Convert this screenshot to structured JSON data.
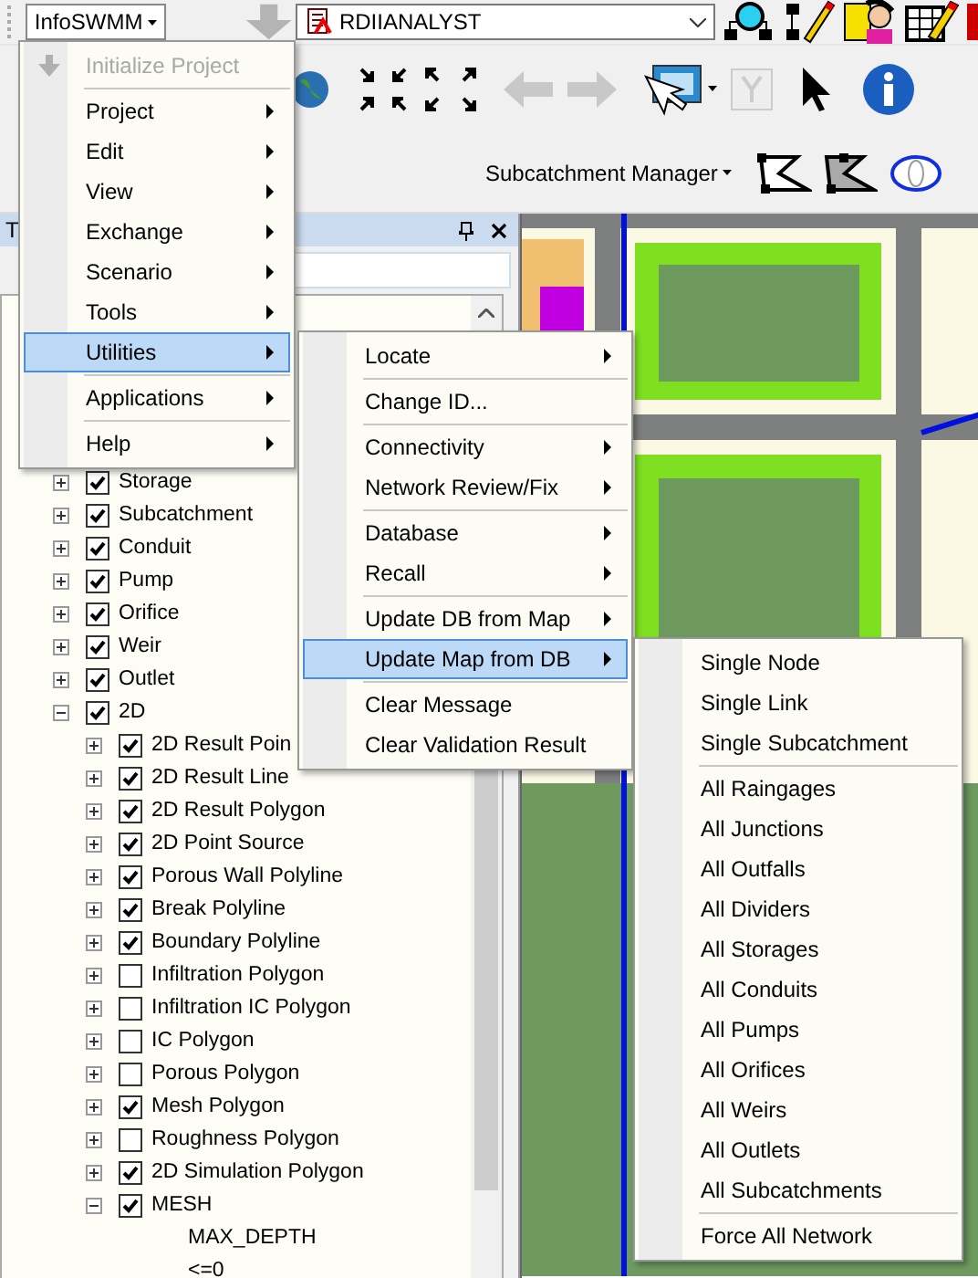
{
  "toolbar": {
    "app_menu": "InfoSWMM",
    "database": "RDIIANALYST"
  },
  "manager_bar": {
    "manager": "Subcatchment Manager"
  },
  "panel": {
    "title": "T"
  },
  "tree": [
    {
      "label": "Storage",
      "kind": "layer",
      "checked": true,
      "expanded": false
    },
    {
      "label": "Subcatchment",
      "kind": "layer",
      "checked": true,
      "expanded": false
    },
    {
      "label": "Conduit",
      "kind": "layer",
      "checked": true,
      "expanded": false
    },
    {
      "label": "Pump",
      "kind": "layer",
      "checked": true,
      "expanded": false
    },
    {
      "label": "Orifice",
      "kind": "layer",
      "checked": true,
      "expanded": false
    },
    {
      "label": "Weir",
      "kind": "layer",
      "checked": true,
      "expanded": false
    },
    {
      "label": "Outlet",
      "kind": "layer",
      "checked": true,
      "expanded": false
    },
    {
      "label": "2D",
      "kind": "layer",
      "checked": true,
      "expanded": true,
      "children": [
        {
          "label": "2D Result Poin",
          "kind": "layer",
          "checked": true,
          "expanded": false
        },
        {
          "label": "2D Result Line",
          "kind": "layer",
          "checked": true,
          "expanded": false
        },
        {
          "label": "2D Result Polygon",
          "kind": "layer",
          "checked": true,
          "expanded": false
        },
        {
          "label": "2D Point Source",
          "kind": "layer",
          "checked": true,
          "expanded": false
        },
        {
          "label": "Porous Wall Polyline",
          "kind": "layer",
          "checked": true,
          "expanded": false
        },
        {
          "label": "Break Polyline",
          "kind": "layer",
          "checked": true,
          "expanded": false
        },
        {
          "label": "Boundary Polyline",
          "kind": "layer",
          "checked": true,
          "expanded": false
        },
        {
          "label": "Infiltration Polygon",
          "kind": "layer",
          "checked": false,
          "expanded": false
        },
        {
          "label": "Infiltration IC Polygon",
          "kind": "layer",
          "checked": false,
          "expanded": false
        },
        {
          "label": "IC Polygon",
          "kind": "layer",
          "checked": false,
          "expanded": false
        },
        {
          "label": "Porous Polygon",
          "kind": "layer",
          "checked": false,
          "expanded": false
        },
        {
          "label": "Mesh Polygon",
          "kind": "layer",
          "checked": true,
          "expanded": false
        },
        {
          "label": "Roughness Polygon",
          "kind": "layer",
          "checked": false,
          "expanded": false
        },
        {
          "label": "2D Simulation Polygon",
          "kind": "layer",
          "checked": true,
          "expanded": false
        },
        {
          "label": "MESH",
          "kind": "layer",
          "checked": true,
          "expanded": true,
          "children": [
            {
              "label": "MAX_DEPTH",
              "kind": "legend"
            },
            {
              "label": "<=0",
              "kind": "legend"
            }
          ]
        }
      ]
    }
  ],
  "menus": [
    {
      "items": [
        {
          "kind": "item",
          "label": "Initialize Project",
          "disabled": true,
          "selected": false,
          "submenu": false
        },
        {
          "kind": "separator"
        },
        {
          "kind": "item",
          "label": "Project",
          "disabled": false,
          "selected": false,
          "submenu": true
        },
        {
          "kind": "item",
          "label": "Edit",
          "disabled": false,
          "selected": false,
          "submenu": true
        },
        {
          "kind": "item",
          "label": "View",
          "disabled": false,
          "selected": false,
          "submenu": true
        },
        {
          "kind": "item",
          "label": "Exchange",
          "disabled": false,
          "selected": false,
          "submenu": true
        },
        {
          "kind": "item",
          "label": "Scenario",
          "disabled": false,
          "selected": false,
          "submenu": true
        },
        {
          "kind": "item",
          "label": "Tools",
          "disabled": false,
          "selected": false,
          "submenu": true
        },
        {
          "kind": "item",
          "label": "Utilities",
          "disabled": false,
          "selected": true,
          "submenu": true
        },
        {
          "kind": "separator"
        },
        {
          "kind": "item",
          "label": "Applications",
          "disabled": false,
          "selected": false,
          "submenu": true
        },
        {
          "kind": "separator"
        },
        {
          "kind": "item",
          "label": "Help",
          "disabled": false,
          "selected": false,
          "submenu": true
        }
      ]
    },
    {
      "items": [
        {
          "kind": "item",
          "label": "Locate",
          "disabled": false,
          "selected": false,
          "submenu": true
        },
        {
          "kind": "separator"
        },
        {
          "kind": "item",
          "label": "Change ID...",
          "disabled": false,
          "selected": false,
          "submenu": false
        },
        {
          "kind": "separator"
        },
        {
          "kind": "item",
          "label": "Connectivity",
          "disabled": false,
          "selected": false,
          "submenu": true
        },
        {
          "kind": "item",
          "label": "Network Review/Fix",
          "disabled": false,
          "selected": false,
          "submenu": true
        },
        {
          "kind": "separator"
        },
        {
          "kind": "item",
          "label": "Database",
          "disabled": false,
          "selected": false,
          "submenu": true
        },
        {
          "kind": "item",
          "label": "Recall",
          "disabled": false,
          "selected": false,
          "submenu": true
        },
        {
          "kind": "separator"
        },
        {
          "kind": "item",
          "label": "Update DB from Map",
          "disabled": false,
          "selected": false,
          "submenu": true
        },
        {
          "kind": "item",
          "label": "Update Map from DB",
          "disabled": false,
          "selected": true,
          "submenu": true
        },
        {
          "kind": "separator"
        },
        {
          "kind": "item",
          "label": "Clear Message",
          "disabled": false,
          "selected": false,
          "submenu": false
        },
        {
          "kind": "item",
          "label": "Clear Validation Result",
          "disabled": false,
          "selected": false,
          "submenu": false
        }
      ]
    },
    {
      "items": [
        {
          "kind": "item",
          "label": "Single Node",
          "disabled": false,
          "selected": false,
          "submenu": false
        },
        {
          "kind": "item",
          "label": "Single Link",
          "disabled": false,
          "selected": false,
          "submenu": false
        },
        {
          "kind": "item",
          "label": "Single Subcatchment",
          "disabled": false,
          "selected": false,
          "submenu": false
        },
        {
          "kind": "separator"
        },
        {
          "kind": "item",
          "label": "All Raingages",
          "disabled": false,
          "selected": false,
          "submenu": false
        },
        {
          "kind": "item",
          "label": "All Junctions",
          "disabled": false,
          "selected": false,
          "submenu": false
        },
        {
          "kind": "item",
          "label": "All Outfalls",
          "disabled": false,
          "selected": false,
          "submenu": false
        },
        {
          "kind": "item",
          "label": "All Dividers",
          "disabled": false,
          "selected": false,
          "submenu": false
        },
        {
          "kind": "item",
          "label": "All Storages",
          "disabled": false,
          "selected": false,
          "submenu": false
        },
        {
          "kind": "item",
          "label": "All Conduits",
          "disabled": false,
          "selected": false,
          "submenu": false
        },
        {
          "kind": "item",
          "label": "All Pumps",
          "disabled": false,
          "selected": false,
          "submenu": false
        },
        {
          "kind": "item",
          "label": "All Orifices",
          "disabled": false,
          "selected": false,
          "submenu": false
        },
        {
          "kind": "item",
          "label": "All Weirs",
          "disabled": false,
          "selected": false,
          "submenu": false
        },
        {
          "kind": "item",
          "label": "All Outlets",
          "disabled": false,
          "selected": false,
          "submenu": false
        },
        {
          "kind": "item",
          "label": "All Subcatchments",
          "disabled": false,
          "selected": false,
          "submenu": false
        },
        {
          "kind": "separator"
        },
        {
          "kind": "item",
          "label": "Force All Network",
          "disabled": false,
          "selected": false,
          "submenu": false
        }
      ]
    }
  ]
}
